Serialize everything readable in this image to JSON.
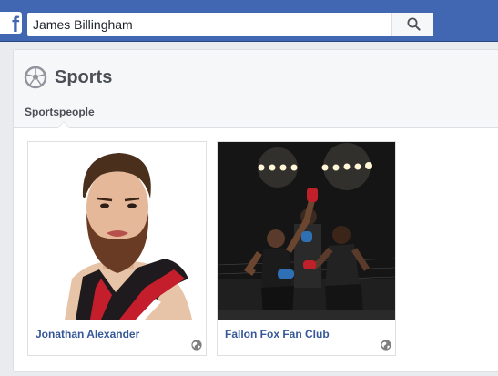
{
  "search": {
    "value": "James Billingham",
    "placeholder": "Search"
  },
  "section": {
    "title": "Sports",
    "tabs": [
      {
        "label": "Sportspeople",
        "active": true
      }
    ]
  },
  "results": [
    {
      "name": "Jonathan Alexander",
      "privacy_icon": "globe-icon"
    },
    {
      "name": "Fallon Fox Fan Club",
      "privacy_icon": "globe-icon"
    }
  ],
  "colors": {
    "brand": "#4267b2",
    "link": "#365899",
    "page_bg": "#e9ebee",
    "header_bg": "#f6f7f9"
  }
}
